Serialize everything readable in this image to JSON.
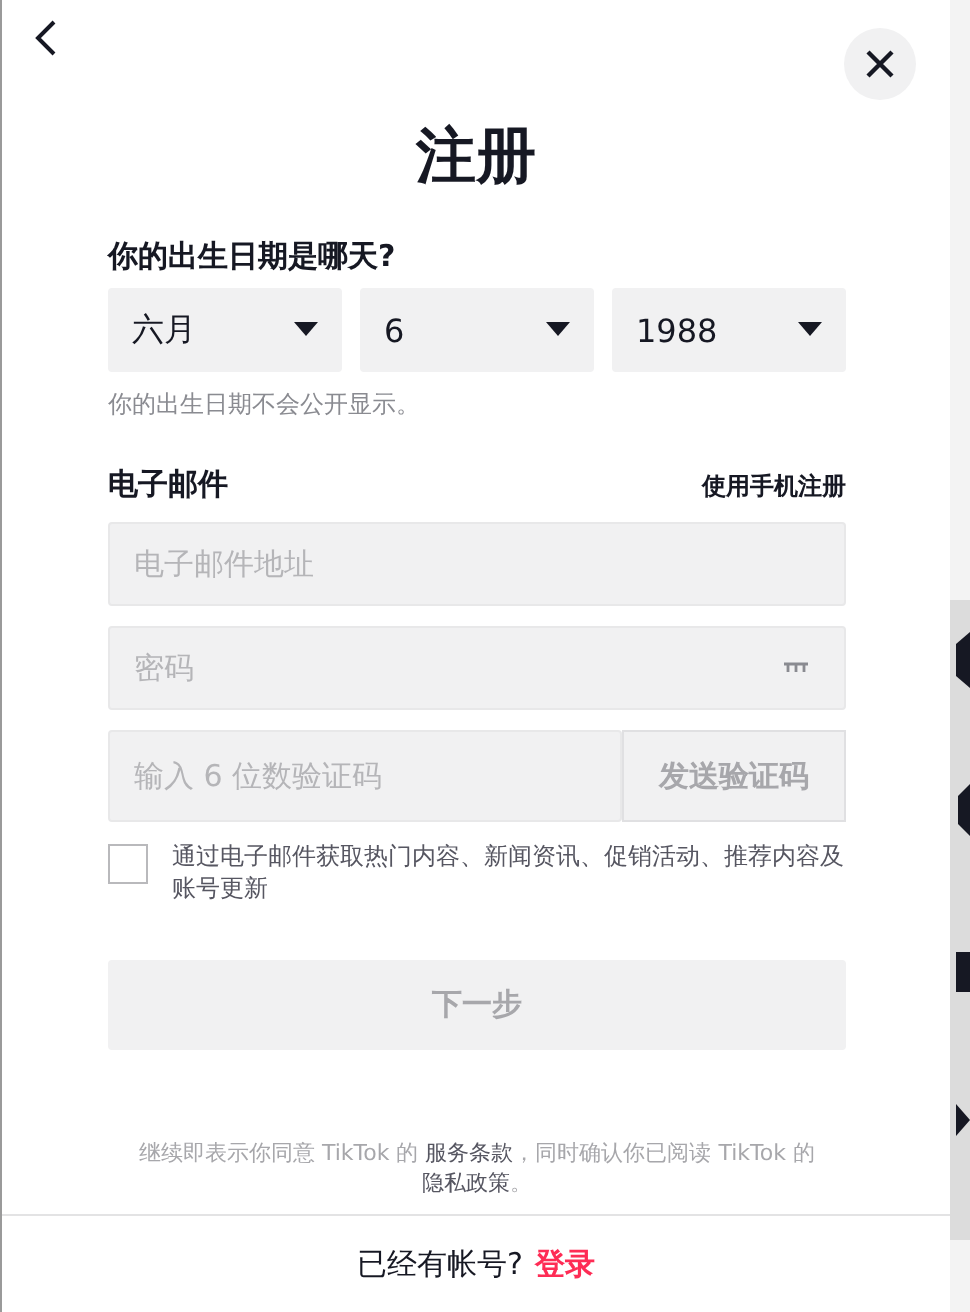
{
  "title": "注册",
  "birthday": {
    "label": "你的出生日期是哪天?",
    "selects": [
      {
        "value": "六月"
      },
      {
        "value": "6"
      },
      {
        "value": "1988"
      }
    ],
    "note": "你的出生日期不会公开显示。"
  },
  "email": {
    "label": "电子邮件",
    "switch_link": "使用手机注册"
  },
  "fields": [
    {
      "kind": "text",
      "placeholder": "电子邮件地址"
    },
    {
      "kind": "password",
      "placeholder": "密码"
    },
    {
      "kind": "code",
      "placeholder": "输入 6 位数验证码",
      "button": "发送验证码",
      "disabled": true
    }
  ],
  "checkbox": {
    "label": "通过电子邮件获取热门内容、新闻资讯、促销活动、推荐内容及账号更新",
    "checked": false
  },
  "next_button": {
    "label": "下一步",
    "disabled": true
  },
  "legal": [
    {
      "kind": "text",
      "text": "继续即表示你同意 TikTok 的 "
    },
    {
      "kind": "link",
      "text": "服务条款"
    },
    {
      "kind": "text",
      "text": "，同时确认你已阅读 TikTok 的 "
    },
    {
      "kind": "link",
      "text": "隐私政策"
    },
    {
      "kind": "text",
      "text": "。"
    }
  ],
  "footer": {
    "prompt": "已经有帐号?",
    "link": "登录"
  }
}
